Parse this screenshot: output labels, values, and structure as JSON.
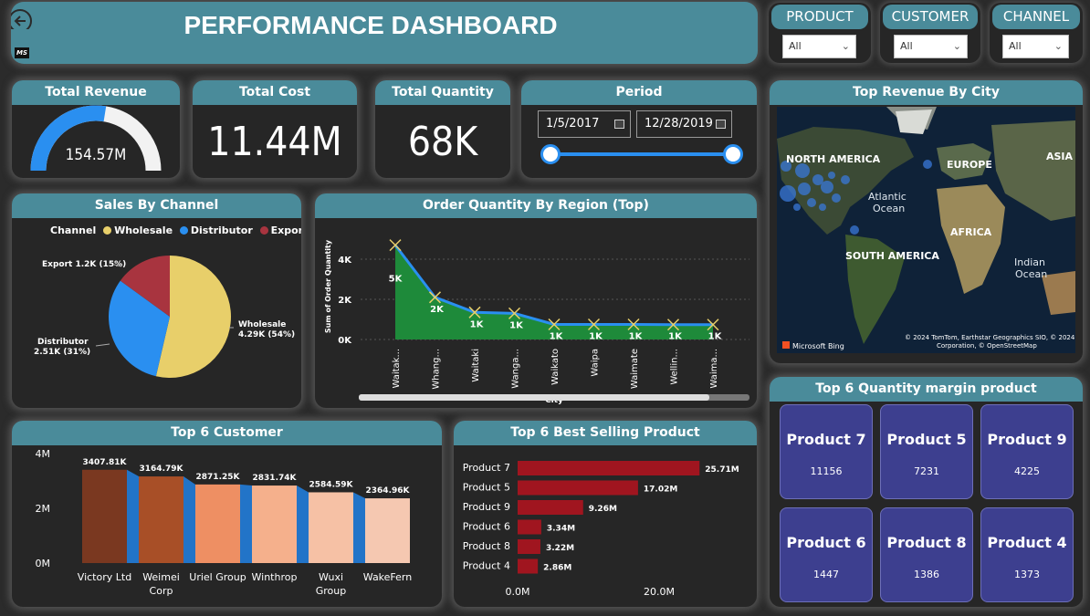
{
  "header": {
    "title": "PERFORMANCE DASHBOARD",
    "logo_text": "MS"
  },
  "slicers": [
    {
      "label": "PRODUCT",
      "value": "All"
    },
    {
      "label": "CUSTOMER",
      "value": "All"
    },
    {
      "label": "CHANNEL",
      "value": "All"
    }
  ],
  "kpis": {
    "revenue": {
      "title": "Total Revenue",
      "value": "154.57M",
      "gauge_fraction": 0.55
    },
    "cost": {
      "title": "Total Cost",
      "value": "11.44M"
    },
    "quantity": {
      "title": "Total Quantity",
      "value": "68K"
    }
  },
  "period": {
    "title": "Period",
    "start": "1/5/2017",
    "end": "12/28/2019"
  },
  "map": {
    "title": "Top Revenue By City",
    "labels": [
      "NORTH AMERICA",
      "EUROPE",
      "ASIA",
      "Atlantic Ocean",
      "AFRICA",
      "SOUTH AMERICA",
      "Indian Ocean"
    ],
    "attribution": "© 2024 TomTom, Earthstar Geographics SIO, © 2024 Microsoft Corporation, © OpenStreetMap",
    "brand": "Microsoft Bing"
  },
  "sales_by_channel": {
    "title": "Sales By Channel",
    "legend_title": "Channel",
    "legend": [
      {
        "name": "Wholesale",
        "color": "#e8cf6a"
      },
      {
        "name": "Distributor",
        "color": "#2a8ff0"
      },
      {
        "name": "Export",
        "color": "#a8343f"
      }
    ],
    "labels": {
      "wholesale": [
        "Wholesale",
        "4.29K (54%)"
      ],
      "distributor": [
        "Distributor",
        "2.51K (31%)"
      ],
      "export": [
        "Export 1.2K (15%)"
      ]
    }
  },
  "order_quantity": {
    "title": "Order Quantity By Region (Top)",
    "ylabel": "Sum of Order Quantity",
    "xlabel": "City",
    "yticks": [
      "4K",
      "2K",
      "0K"
    ]
  },
  "top_customer": {
    "title": "Top 6 Customer",
    "yticks": [
      "4M",
      "2M",
      "0M"
    ]
  },
  "best_selling": {
    "title": "Top 6 Best Selling Product",
    "xticks": [
      "0.0M",
      "20.0M"
    ]
  },
  "quantity_margin": {
    "title": "Top 6 Quantity margin product",
    "products": [
      {
        "name": "Product 7",
        "value": "11156"
      },
      {
        "name": "Product 5",
        "value": "7231"
      },
      {
        "name": "Product 9",
        "value": "4225"
      },
      {
        "name": "Product 6",
        "value": "1447"
      },
      {
        "name": "Product 8",
        "value": "1386"
      },
      {
        "name": "Product 4",
        "value": "1373"
      }
    ]
  },
  "chart_data": [
    {
      "type": "pie",
      "title": "Sales By Channel",
      "categories": [
        "Wholesale",
        "Distributor",
        "Export"
      ],
      "values": [
        4290,
        2510,
        1200
      ],
      "percent": [
        54,
        31,
        15
      ]
    },
    {
      "type": "area",
      "title": "Order Quantity By Region (Top)",
      "xlabel": "City",
      "ylabel": "Sum of Order Quantity",
      "categories": [
        "Waitak...",
        "Whang...",
        "Waitaki",
        "Wanga...",
        "Waikato",
        "Waipa",
        "Waimate",
        "Wellin...",
        "Waima..."
      ],
      "values": [
        4700,
        2100,
        1350,
        1300,
        750,
        750,
        750,
        740,
        740
      ],
      "data_labels": [
        "5K",
        "2K",
        "1K",
        "1K",
        "1K",
        "1K",
        "1K",
        "1K",
        "1K"
      ],
      "ylim": [
        0,
        5000
      ]
    },
    {
      "type": "bar",
      "title": "Top 6 Customer",
      "categories": [
        "Victory Ltd",
        "Weimei Corp",
        "Uriel Group",
        "Winthrop",
        "Wuxi Group",
        "WakeFern"
      ],
      "values": [
        3407.81,
        3164.79,
        2871.25,
        2831.74,
        2584.59,
        2364.96
      ],
      "data_labels": [
        "3407.81K",
        "3164.79K",
        "2871.25K",
        "2831.74K",
        "2584.59K",
        "2364.96K"
      ],
      "ylim": [
        0,
        4000
      ]
    },
    {
      "type": "bar",
      "title": "Top 6 Best Selling Product",
      "categories": [
        "Product 7",
        "Product 5",
        "Product 9",
        "Product 6",
        "Product 8",
        "Product 4"
      ],
      "values": [
        25.71,
        17.02,
        9.26,
        3.34,
        3.22,
        2.86
      ],
      "data_labels": [
        "25.71M",
        "17.02M",
        "9.26M",
        "3.34M",
        "3.22M",
        "2.86M"
      ],
      "xlim": [
        0,
        30
      ]
    }
  ]
}
